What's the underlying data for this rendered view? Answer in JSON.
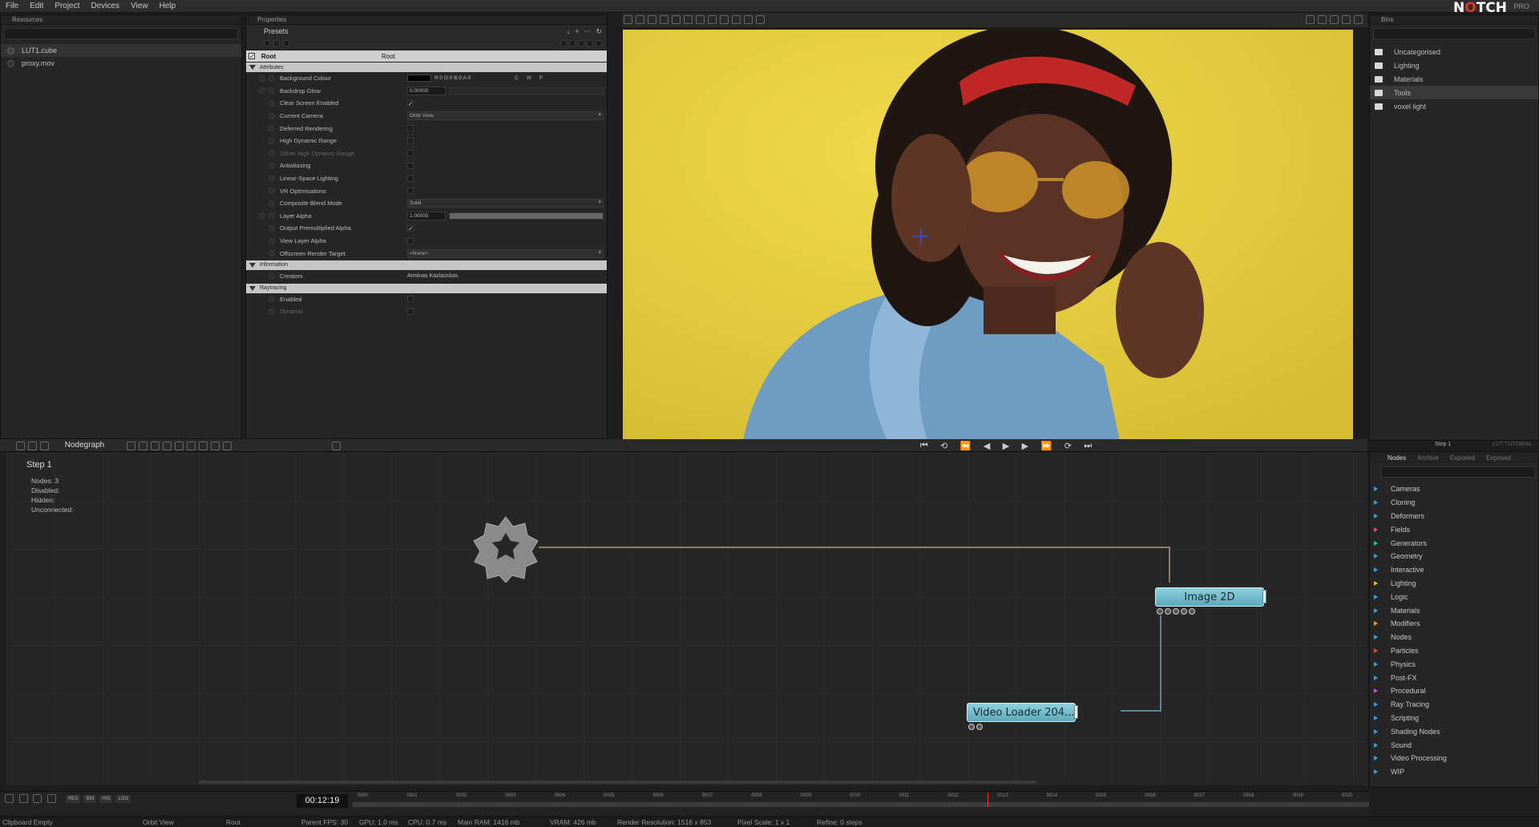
{
  "menu": [
    "File",
    "Edit",
    "Project",
    "Devices",
    "View",
    "Help"
  ],
  "logo": {
    "brand_prefix": "N",
    "brand_o": "O",
    "brand_suffix": "TCH",
    "edition": "PRO"
  },
  "resources": {
    "title": "Resources",
    "items": [
      {
        "label": "LUT1.cube",
        "selected": true
      },
      {
        "label": "proxy.mov",
        "selected": false
      }
    ]
  },
  "properties": {
    "title": "Properties",
    "presets_label": "Presets",
    "root_label": "Root",
    "root_value": "Root",
    "sections": {
      "attributes": "Attributes",
      "information": "Information",
      "raytracing": "Raytracing"
    },
    "attributes": [
      {
        "label": "Background Colour",
        "type": "color",
        "value": "R:0 G:0 B:0 A:0",
        "buttons": [
          "C",
          "W",
          "P"
        ]
      },
      {
        "label": "Backdrop Glow",
        "type": "number",
        "value": "0.00000"
      },
      {
        "label": "Clear Screen Enabled",
        "type": "check",
        "checked": true
      },
      {
        "label": "Current Camera",
        "type": "dropdown",
        "value": "Orbit View"
      },
      {
        "label": "Deferred Rendering",
        "type": "check",
        "checked": false
      },
      {
        "label": "High Dynamic Range",
        "type": "check",
        "checked": false
      },
      {
        "label": "Dither High Dynamic Range",
        "type": "check",
        "checked": false,
        "dim": true
      },
      {
        "label": "Antialiasing",
        "type": "check",
        "checked": false
      },
      {
        "label": "Linear-Space Lighting",
        "type": "check",
        "checked": false
      },
      {
        "label": "VR Optimisations",
        "type": "check",
        "checked": false
      },
      {
        "label": "Composite Blend Mode",
        "type": "dropdown",
        "value": "Solid"
      },
      {
        "label": "Layer Alpha",
        "type": "number",
        "value": "1.00000"
      },
      {
        "label": "Output Premultiplied Alpha",
        "type": "check",
        "checked": true
      },
      {
        "label": "View Layer Alpha",
        "type": "check",
        "checked": false
      },
      {
        "label": "Offscreen Render Target",
        "type": "dropdown",
        "value": "<None>"
      }
    ],
    "information": [
      {
        "label": "Creators",
        "value": "Arminas Kazlauskas"
      }
    ],
    "raytracing": [
      {
        "label": "Enabled",
        "checked": false
      },
      {
        "label": "Dynamic",
        "checked": false,
        "dim": true
      }
    ]
  },
  "bins": {
    "title": "Bins",
    "items": [
      {
        "label": "Uncategorised",
        "selected": false
      },
      {
        "label": "Lighting",
        "selected": false
      },
      {
        "label": "Materials",
        "selected": false
      },
      {
        "label": "Tools",
        "selected": true
      },
      {
        "label": "voxel light",
        "selected": false
      }
    ]
  },
  "nodegraph": {
    "tab_label": "Nodegraph",
    "step_title": "Step 1",
    "stats": [
      {
        "label": "Nodes:",
        "value": "3"
      },
      {
        "label": "Disabled:",
        "value": ""
      },
      {
        "label": "Hidden:",
        "value": ""
      },
      {
        "label": "Unconnected:",
        "value": ""
      }
    ],
    "nodes": {
      "image2d": "Image 2D",
      "video_loader": "Video Loader 204..."
    }
  },
  "nodes_panel": {
    "tabs": [
      "Nodes",
      "Archive",
      "Exposed",
      "Exposed"
    ],
    "step_tab": "Step 1",
    "tutorial_tab": "LUT TUTORIAL",
    "categories": [
      {
        "label": "Cameras",
        "color": "#3aa0d8"
      },
      {
        "label": "Cloning",
        "color": "#3aa0d8"
      },
      {
        "label": "Deformers",
        "color": "#3aa0d8"
      },
      {
        "label": "Fields",
        "color": "#d84a9a"
      },
      {
        "label": "Generators",
        "color": "#3ab8a0"
      },
      {
        "label": "Geometry",
        "color": "#3aa0d8"
      },
      {
        "label": "Interactive",
        "color": "#3aa0d8"
      },
      {
        "label": "Lighting",
        "color": "#d8c03a"
      },
      {
        "label": "Logic",
        "color": "#3aa0d8"
      },
      {
        "label": "Materials",
        "color": "#3aa0d8"
      },
      {
        "label": "Modifiers",
        "color": "#d8a03a"
      },
      {
        "label": "Nodes",
        "color": "#3aa0d8"
      },
      {
        "label": "Particles",
        "color": "#d8503a"
      },
      {
        "label": "Physics",
        "color": "#3aa0d8"
      },
      {
        "label": "Post-FX",
        "color": "#3aa0d8"
      },
      {
        "label": "Procedural",
        "color": "#d84ad8"
      },
      {
        "label": "Ray Tracing",
        "color": "#3aa0d8"
      },
      {
        "label": "Scripting",
        "color": "#3aa0d8"
      },
      {
        "label": "Shading Nodes",
        "color": "#3aa0d8"
      },
      {
        "label": "Sound",
        "color": "#3aa0d8"
      },
      {
        "label": "Video Processing",
        "color": "#3aa0d8"
      },
      {
        "label": "WIP",
        "color": "#3aa0d8"
      }
    ]
  },
  "timeline": {
    "timecode": "00:12:19",
    "mode_buttons": [
      "RES",
      "BIN",
      "HIS",
      "LOG"
    ],
    "ticks": [
      "0000",
      "0001",
      "0002",
      "0003",
      "0004",
      "0005",
      "0006",
      "0007",
      "0008",
      "0009",
      "0010",
      "0011",
      "0012",
      "0013",
      "0014",
      "0015",
      "0016",
      "0017",
      "0018",
      "0019",
      "0020"
    ]
  },
  "status": {
    "clipboard": "Clipboard Empty",
    "camera": "Orbit View",
    "layer": "Root",
    "parent_fps": "Parent FPS: 30",
    "gpu": "GPU: 1.0 ms",
    "cpu": "CPU: 0.7 ms",
    "ram": "Main RAM: 1416 mb",
    "vram": "VRAM: 426 mb",
    "render_res": "Render Resolution: 1516 x 853",
    "pixel_scale": "Pixel Scale: 1 x 1",
    "refine": "Refine: 0 steps"
  },
  "colors": {
    "accent_node": "#7cc4d4",
    "logo_accent": "#e0352b",
    "viewport_bg": "#e7d141"
  }
}
